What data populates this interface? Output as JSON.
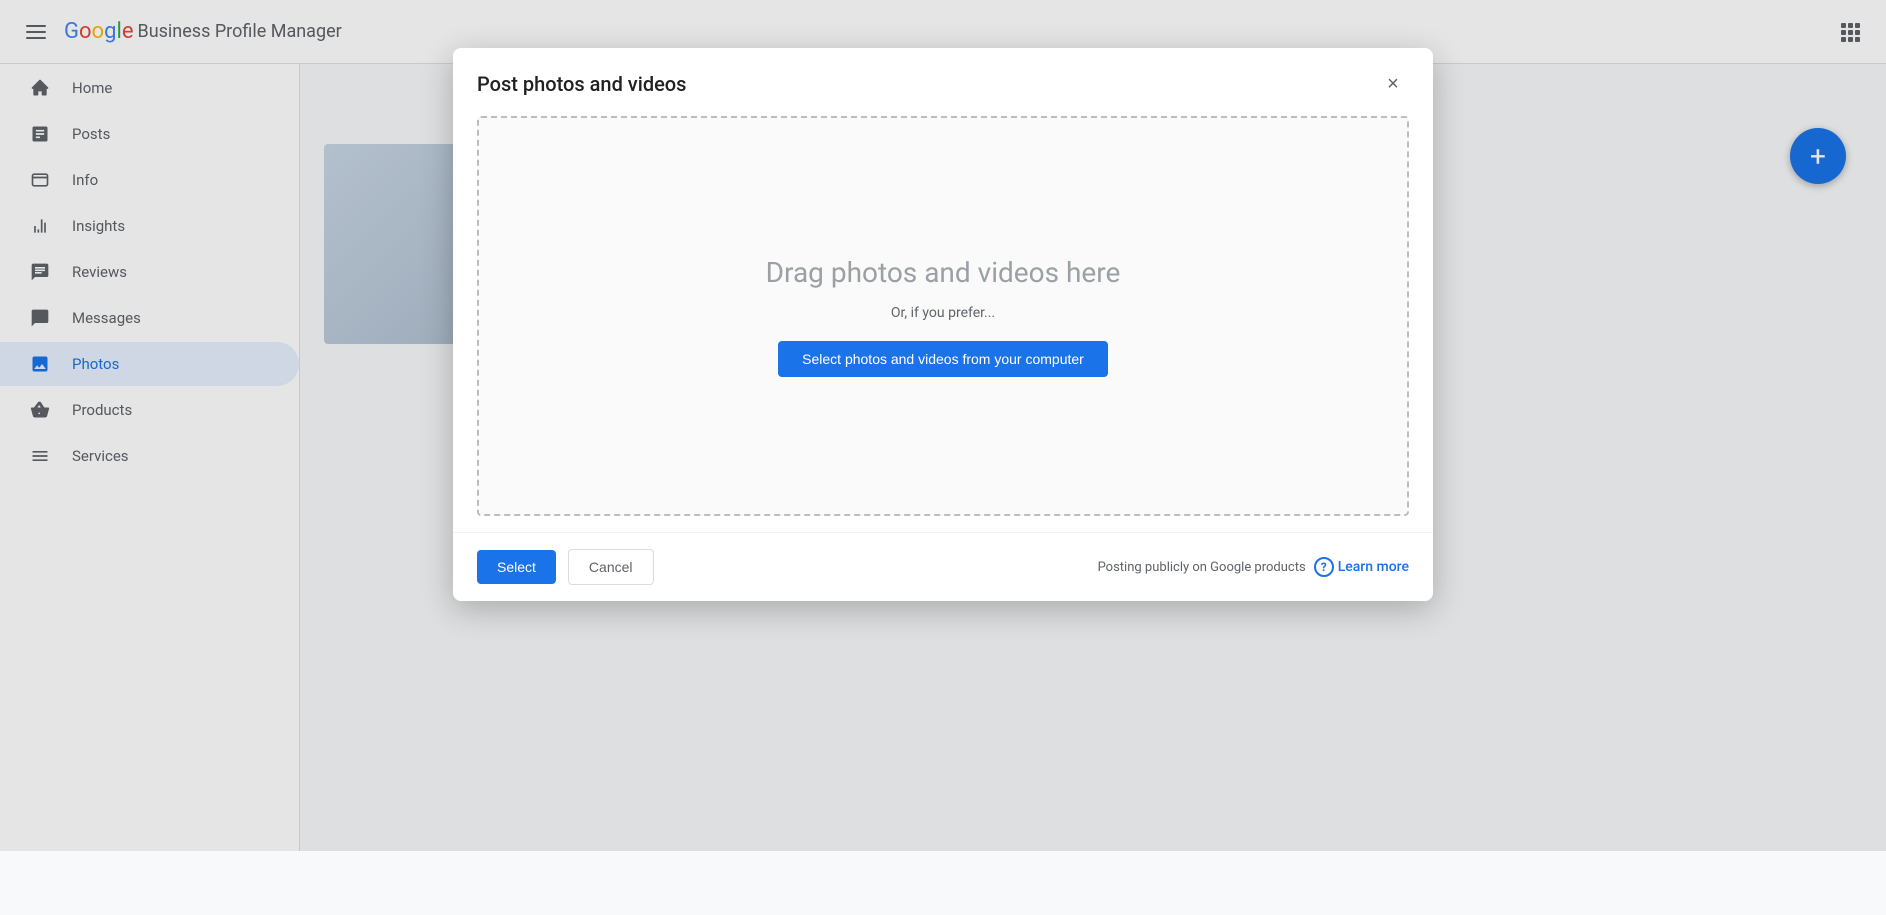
{
  "header": {
    "menu_label": "Menu",
    "logo_text": "Google",
    "title": "Business Profile Manager",
    "apps_label": "Google apps"
  },
  "sidebar": {
    "items": [
      {
        "id": "home",
        "label": "Home",
        "icon": "⊞"
      },
      {
        "id": "posts",
        "label": "Posts",
        "icon": "☰"
      },
      {
        "id": "info",
        "label": "Info",
        "icon": "🏪"
      },
      {
        "id": "insights",
        "label": "Insights",
        "icon": "📊"
      },
      {
        "id": "reviews",
        "label": "Reviews",
        "icon": "⭐"
      },
      {
        "id": "messages",
        "label": "Messages",
        "icon": "💬"
      },
      {
        "id": "photos",
        "label": "Photos",
        "icon": "🖼"
      },
      {
        "id": "products",
        "label": "Products",
        "icon": "🛒"
      },
      {
        "id": "services",
        "label": "Services",
        "icon": "≡"
      }
    ]
  },
  "fab": {
    "label": "+",
    "aria": "Add"
  },
  "modal": {
    "title": "Post photos and videos",
    "close_label": "×",
    "dropzone": {
      "title": "Drag photos and videos here",
      "subtitle": "Or, if you prefer...",
      "select_btn_label": "Select photos and videos from your computer"
    },
    "footer": {
      "select_label": "Select",
      "cancel_label": "Cancel",
      "info_text": "Posting publicly on Google products",
      "learn_more_label": "Learn more",
      "help_icon_label": "?"
    }
  }
}
